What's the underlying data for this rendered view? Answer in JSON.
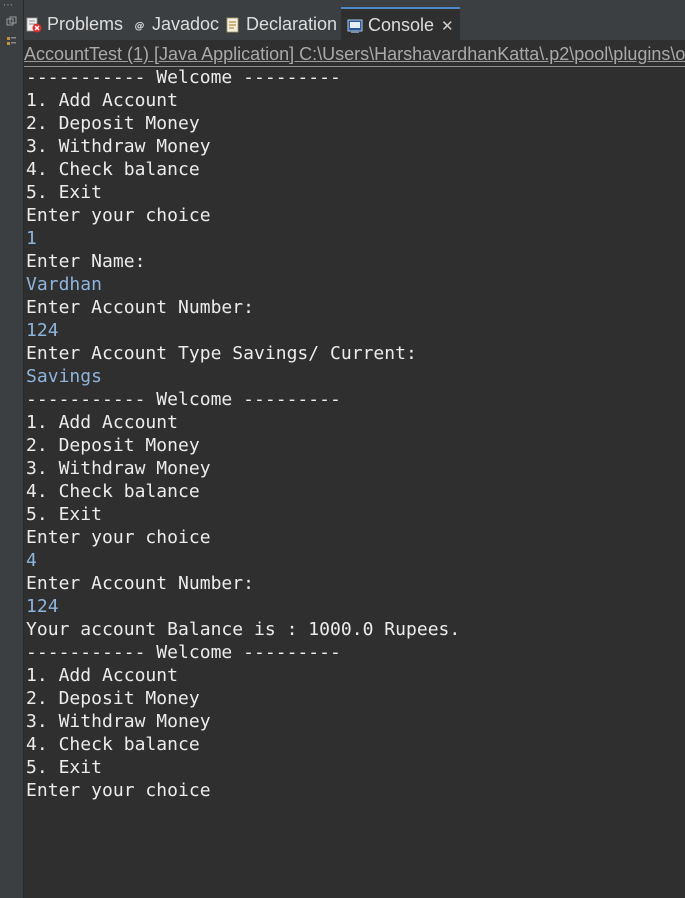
{
  "tabs": [
    {
      "label": "Problems",
      "icon": "problems-icon",
      "active": false
    },
    {
      "label": "Javadoc",
      "icon": "javadoc-icon",
      "active": false
    },
    {
      "label": "Declaration",
      "icon": "declaration-icon",
      "active": false
    },
    {
      "label": "Console",
      "icon": "console-icon",
      "active": true,
      "close": "✕"
    }
  ],
  "launch_description": "AccountTest (1) [Java Application] C:\\Users\\HarshavardhanKatta\\.p2\\pool\\plugins\\or",
  "colors": {
    "background": "#2f2f2f",
    "output_text": "#ececec",
    "input_text": "#8fb4dc",
    "active_tab_accent": "#4a88c7"
  },
  "console": [
    {
      "text": "----------- Welcome ---------",
      "type": "output"
    },
    {
      "text": "1. Add Account",
      "type": "output"
    },
    {
      "text": "2. Deposit Money",
      "type": "output"
    },
    {
      "text": "3. Withdraw Money",
      "type": "output"
    },
    {
      "text": "4. Check balance",
      "type": "output"
    },
    {
      "text": "5. Exit",
      "type": "output"
    },
    {
      "text": "Enter your choice",
      "type": "output"
    },
    {
      "text": "1",
      "type": "input"
    },
    {
      "text": "Enter Name:",
      "type": "output"
    },
    {
      "text": "Vardhan",
      "type": "input"
    },
    {
      "text": "Enter Account Number:",
      "type": "output"
    },
    {
      "text": "124",
      "type": "input"
    },
    {
      "text": "Enter Account Type Savings/ Current:",
      "type": "output"
    },
    {
      "text": "Savings",
      "type": "input"
    },
    {
      "text": "----------- Welcome ---------",
      "type": "output"
    },
    {
      "text": "1. Add Account",
      "type": "output"
    },
    {
      "text": "2. Deposit Money",
      "type": "output"
    },
    {
      "text": "3. Withdraw Money",
      "type": "output"
    },
    {
      "text": "4. Check balance",
      "type": "output"
    },
    {
      "text": "5. Exit",
      "type": "output"
    },
    {
      "text": "Enter your choice",
      "type": "output"
    },
    {
      "text": "4",
      "type": "input"
    },
    {
      "text": "Enter Account Number:",
      "type": "output"
    },
    {
      "text": "124",
      "type": "input"
    },
    {
      "text": "Your account Balance is : 1000.0 Rupees.",
      "type": "output"
    },
    {
      "text": "----------- Welcome ---------",
      "type": "output"
    },
    {
      "text": "1. Add Account",
      "type": "output"
    },
    {
      "text": "2. Deposit Money",
      "type": "output"
    },
    {
      "text": "3. Withdraw Money",
      "type": "output"
    },
    {
      "text": "4. Check balance",
      "type": "output"
    },
    {
      "text": "5. Exit",
      "type": "output"
    },
    {
      "text": "Enter your choice",
      "type": "output"
    }
  ]
}
